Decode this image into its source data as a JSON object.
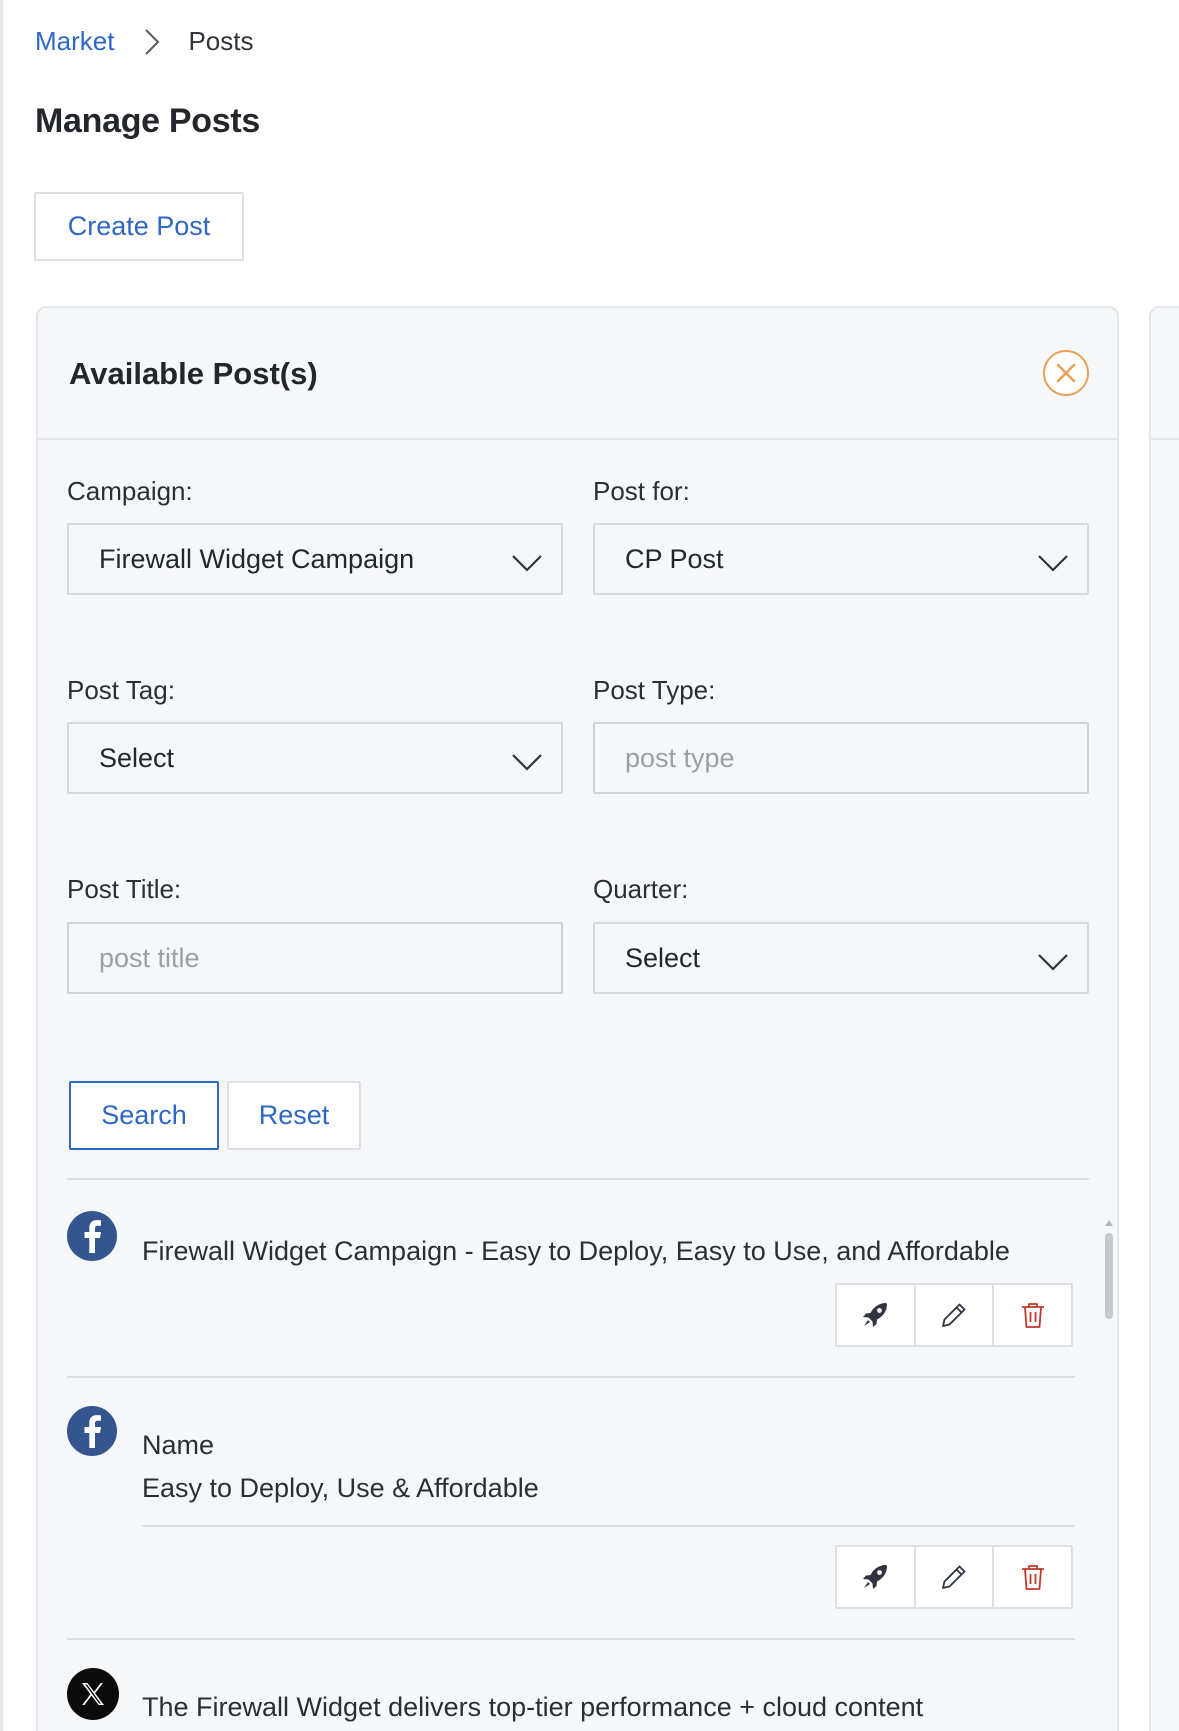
{
  "breadcrumb": {
    "items": [
      {
        "label": "Market"
      },
      {
        "label": "Posts"
      }
    ]
  },
  "page": {
    "title": "Manage Posts",
    "create_button": "Create Post"
  },
  "panel": {
    "title": "Available Post(s)",
    "filters": {
      "campaign": {
        "label": "Campaign:",
        "value": "Firewall Widget Campaign"
      },
      "post_for": {
        "label": "Post for:",
        "value": "CP Post"
      },
      "post_tag": {
        "label": "Post Tag:",
        "value": "Select"
      },
      "post_type": {
        "label": "Post Type:",
        "value": "",
        "placeholder": "post type"
      },
      "post_title": {
        "label": "Post Title:",
        "value": "",
        "placeholder": "post title"
      },
      "quarter": {
        "label": "Quarter:",
        "value": "Select"
      }
    },
    "search_button": "Search",
    "reset_button": "Reset",
    "posts": [
      {
        "network": "facebook-icon",
        "text": "Firewall Widget Campaign - Easy to Deploy, Easy to Use, and Affordable"
      },
      {
        "network": "facebook-icon",
        "name_label": "Name",
        "text": "Easy to Deploy, Use & Affordable"
      },
      {
        "network": "x-icon",
        "text": "The Firewall Widget delivers top-tier performance + cloud content"
      }
    ]
  },
  "colors": {
    "link": "#2f67c5",
    "close_accent": "#e8a25a",
    "delete": "#c0392b",
    "facebook": "#34558e",
    "x": "#0b0b0b"
  }
}
